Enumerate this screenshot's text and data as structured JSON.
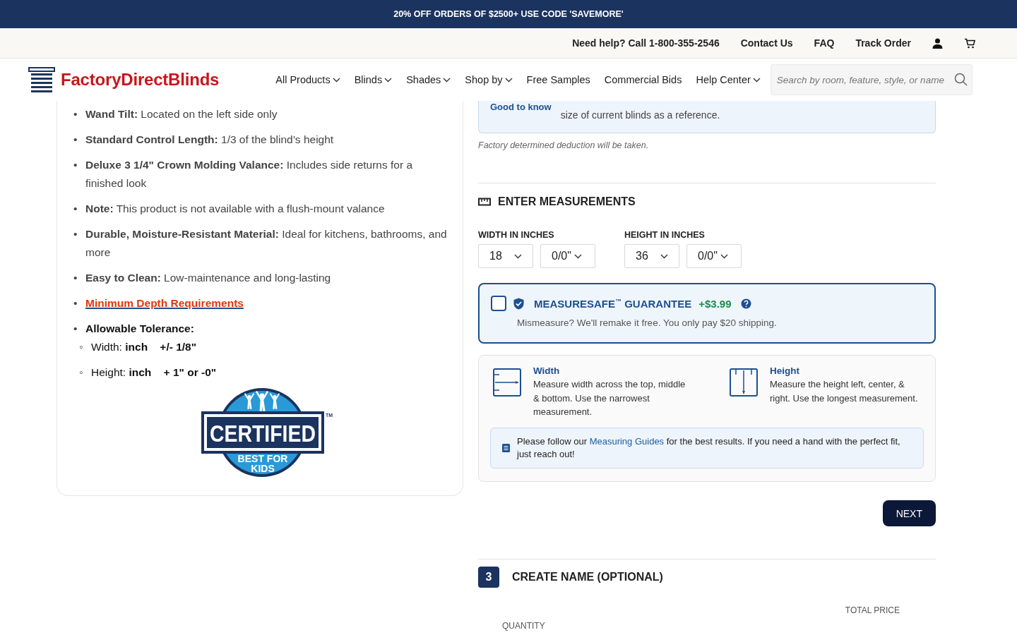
{
  "promo": {
    "text": "20% OFF ORDERS OF $2500+ USE CODE 'SAVEMORE'"
  },
  "utility_nav": {
    "help": "Need help? Call 1-800-355-2546",
    "links": [
      "Contact Us",
      "FAQ",
      "Track Order"
    ]
  },
  "header": {
    "logo": "FactoryDirectBlinds",
    "menu": [
      {
        "label": "All Products",
        "dropdown": true
      },
      {
        "label": "Blinds",
        "dropdown": true
      },
      {
        "label": "Shades",
        "dropdown": true
      },
      {
        "label": "Shop by",
        "dropdown": true
      },
      {
        "label": "Free Samples",
        "dropdown": false
      },
      {
        "label": "Commercial Bids",
        "dropdown": false
      },
      {
        "label": "Help Center",
        "dropdown": true
      }
    ],
    "search": {
      "placeholder": "Search by room, feature, style, or name"
    }
  },
  "features": {
    "bullet": "•",
    "sub_bullet": "◦",
    "items": [
      {
        "kind": "text",
        "label": "Wand Tilt:",
        "text": "Located on the left side only"
      },
      {
        "kind": "text",
        "label": "Standard Control Length:",
        "text": "1/3 of the blind’s height"
      },
      {
        "kind": "text",
        "label": "Deluxe 3 1/4\" Crown Molding Valance:",
        "text": "Includes side returns for a finished look"
      },
      {
        "kind": "text",
        "label": "Note:",
        "text": "This product is not available with a flush-mount valance"
      },
      {
        "kind": "text",
        "label": "Durable, Moisture-Resistant Material:",
        "text": "Ideal for kitchens, bathrooms, and more"
      },
      {
        "kind": "text",
        "label": "Easy to Clean:",
        "text": "Low-maintenance and long-lasting"
      },
      {
        "kind": "link",
        "text": "Minimum Depth Requirements"
      },
      {
        "kind": "group",
        "label": "Allowable Tolerance:",
        "children": [
          {
            "label": "Width:",
            "unit": "inch",
            "value": "+/- 1/8\""
          },
          {
            "label": "Height:",
            "unit": "inch",
            "value": "+ 1\" or -0\""
          }
        ]
      }
    ],
    "badge": {
      "title": "CERTIFIED",
      "lines": [
        "BEST FOR",
        "KIDS"
      ],
      "mark": "TM"
    }
  },
  "good_to_know": {
    "title": "Good to know",
    "text": "size of current blinds as a reference."
  },
  "deduction_note": "Factory determined deduction will be taken.",
  "measurements": {
    "title": "ENTER MEASUREMENTS",
    "fields": [
      {
        "label": "WIDTH IN INCHES",
        "whole": "18",
        "fraction": "0/0\""
      },
      {
        "label": "HEIGHT IN INCHES",
        "whole": "36",
        "fraction": "0/0\""
      }
    ]
  },
  "guarantee": {
    "checked": false,
    "title": "MEASURESAFE$^{™}$ GUARANTEE",
    "price": "+$3.99",
    "text": "Mismeasure? We'll remake it free. You only pay $20 shipping."
  },
  "guides": {
    "items": [
      {
        "kind": "width",
        "title": "Width",
        "text": "Measure width across the top, middle & bottom. Use the narrowest measurement."
      },
      {
        "kind": "height",
        "title": "Height",
        "text": "Measure the height left, center, & right. Use the longest measurement."
      }
    ],
    "tip": {
      "before": "Please follow our",
      "link": "Measuring Guides",
      "after": "for the best results. If you need a hand with the perfect fit, just reach out!"
    }
  },
  "next_button": "NEXT",
  "step": {
    "number": "3",
    "title": "CREATE NAME (OPTIONAL)"
  },
  "summary": {
    "total_label": "TOTAL PRICE",
    "quantity_label": "QUANTITY"
  }
}
